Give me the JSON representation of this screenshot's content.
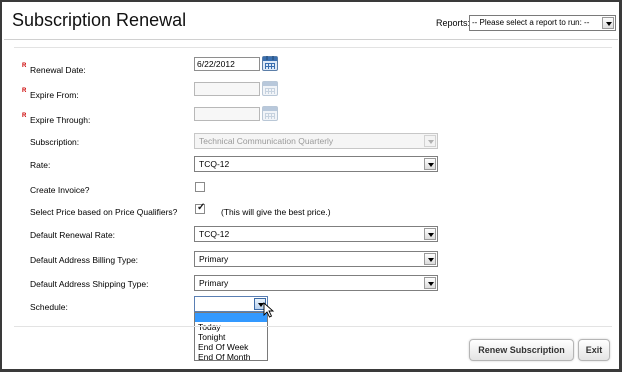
{
  "header": {
    "title": "Subscription Renewal",
    "reports_label": "Reports:",
    "reports_select_value": "-- Please select a report to run: --"
  },
  "required_marker": "R",
  "form": {
    "renewal_date": {
      "label": "Renewal Date:",
      "value": "6/22/2012",
      "icon": "calendar-icon"
    },
    "expire_from": {
      "label": "Expire From:",
      "value": "",
      "icon": "calendar-icon"
    },
    "expire_through": {
      "label": "Expire Through:",
      "value": "",
      "icon": "calendar-icon"
    },
    "subscription": {
      "label": "Subscription:",
      "value": "Technical Communication Quarterly"
    },
    "rate": {
      "label": "Rate:",
      "value": "TCQ-12"
    },
    "create_invoice": {
      "label": "Create Invoice?",
      "checked": false
    },
    "select_price": {
      "label": "Select Price based on Price Qualifiers?",
      "checked": true,
      "hint": "(This will give the best price.)"
    },
    "default_renewal_rate": {
      "label": "Default Renewal Rate:",
      "value": "TCQ-12"
    },
    "default_billing_type": {
      "label": "Default Address Billing Type:",
      "value": "Primary"
    },
    "default_shipping_type": {
      "label": "Default Address Shipping Type:",
      "value": "Primary"
    },
    "schedule": {
      "label": "Schedule:",
      "value": "",
      "options": [
        "",
        "Today",
        "Tonight",
        "End Of Week",
        "End Of Month"
      ]
    }
  },
  "buttons": {
    "renew": "Renew Subscription",
    "exit": "Exit"
  },
  "colors": {
    "required": "#cc0000",
    "highlight": "#3399ff",
    "calendar": "#3a6fb0"
  }
}
